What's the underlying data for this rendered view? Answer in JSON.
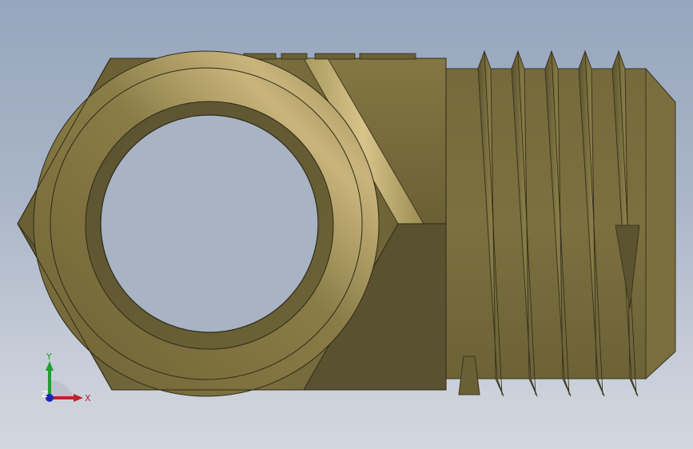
{
  "viewport": {
    "view_name": "Front",
    "background_top": "#97a6bd",
    "background_bottom": "#d3d7de"
  },
  "model": {
    "part": "threaded-hex-elbow-fitting",
    "material_color": "#7e7240",
    "highlight_color": "#d8c48a",
    "shadow_color": "#3f3a22"
  },
  "triad": {
    "x_label": "X",
    "y_label": "Y",
    "z_label": "Z",
    "x_color": "#c0222a",
    "y_color": "#1fa030",
    "z_color": "#1a2ab8"
  }
}
